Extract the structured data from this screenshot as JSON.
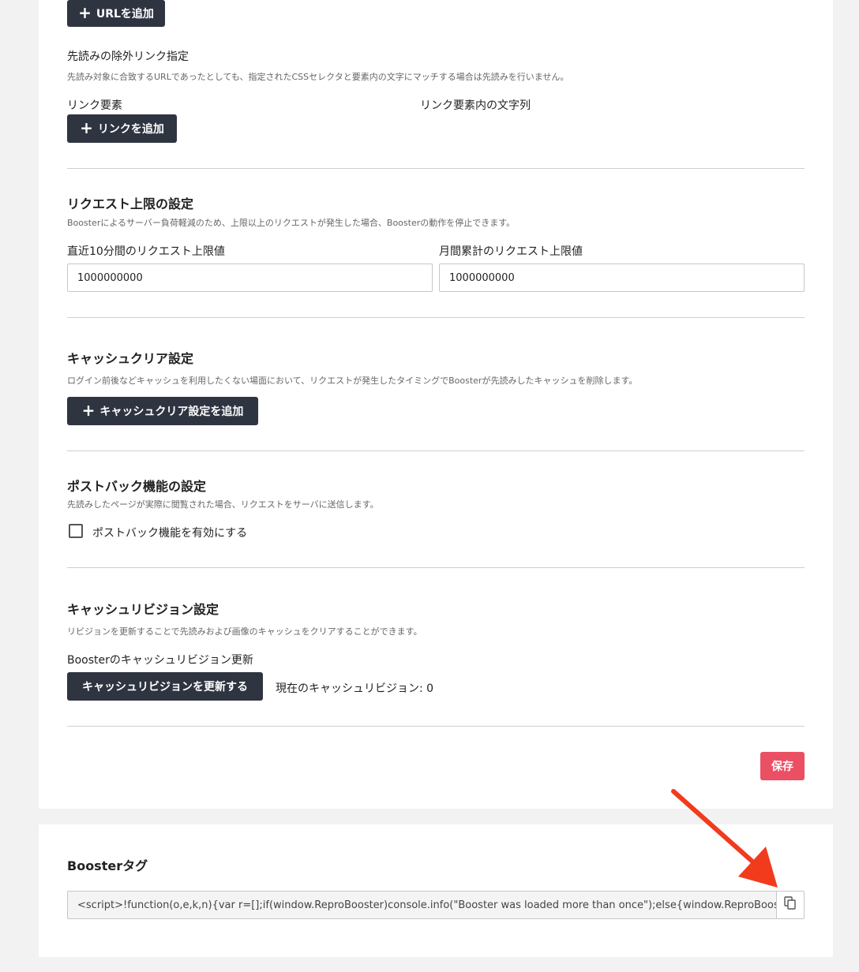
{
  "prefetch": {
    "add_url_label": "URLを追加",
    "exclude_title": "先読みの除外リンク指定",
    "exclude_desc": "先読み対象に合致するURLであったとしても、指定されたCSSセレクタと要素内の文字にマッチする場合は先読みを行いません。",
    "link_element_label": "リンク要素",
    "link_text_label": "リンク要素内の文字列",
    "add_link_label": "リンクを追加"
  },
  "request_limit": {
    "title": "リクエスト上限の設定",
    "desc": "Boosterによるサーバー負荷軽減のため、上限以上のリクエストが発生した場合、Boosterの動作を停止できます。",
    "ten_min_label": "直近10分間のリクエスト上限値",
    "ten_min_value": "1000000000",
    "monthly_label": "月間累計のリクエスト上限値",
    "monthly_value": "1000000000"
  },
  "cache_clear": {
    "title": "キャッシュクリア設定",
    "desc": "ログイン前後などキャッシュを利用したくない場面において、リクエストが発生したタイミングでBoosterが先読みしたキャッシュを削除します。",
    "add_label": "キャッシュクリア設定を追加"
  },
  "postback": {
    "title": "ポストバック機能の設定",
    "desc": "先読みしたページが実際に閲覧された場合、リクエストをサーバに送信します。",
    "checkbox_label": "ポストバック機能を有効にする",
    "checked": false
  },
  "cache_revision": {
    "title": "キャッシュリビジョン設定",
    "desc": "リビジョンを更新することで先読みおよび画像のキャッシュをクリアすることができます。",
    "sub_label": "Boosterのキャッシュリビジョン更新",
    "update_button": "キャッシュリビジョンを更新する",
    "current_revision_text": "現在のキャッシュリビジョン: 0"
  },
  "save_label": "保存",
  "booster_tag": {
    "title": "Boosterタグ",
    "value": "<script>!function(o,e,k,n){var r=[];if(window.ReproBooster)console.info(\"Booster was loaded more than once\");else{window.ReproBoos",
    "copy_icon": "copy-icon"
  },
  "colors": {
    "dark_button": "#2f3441",
    "save_button": "#ea4f63",
    "annotation_arrow": "#f23a1c",
    "page_bg": "#f2f2f2"
  }
}
